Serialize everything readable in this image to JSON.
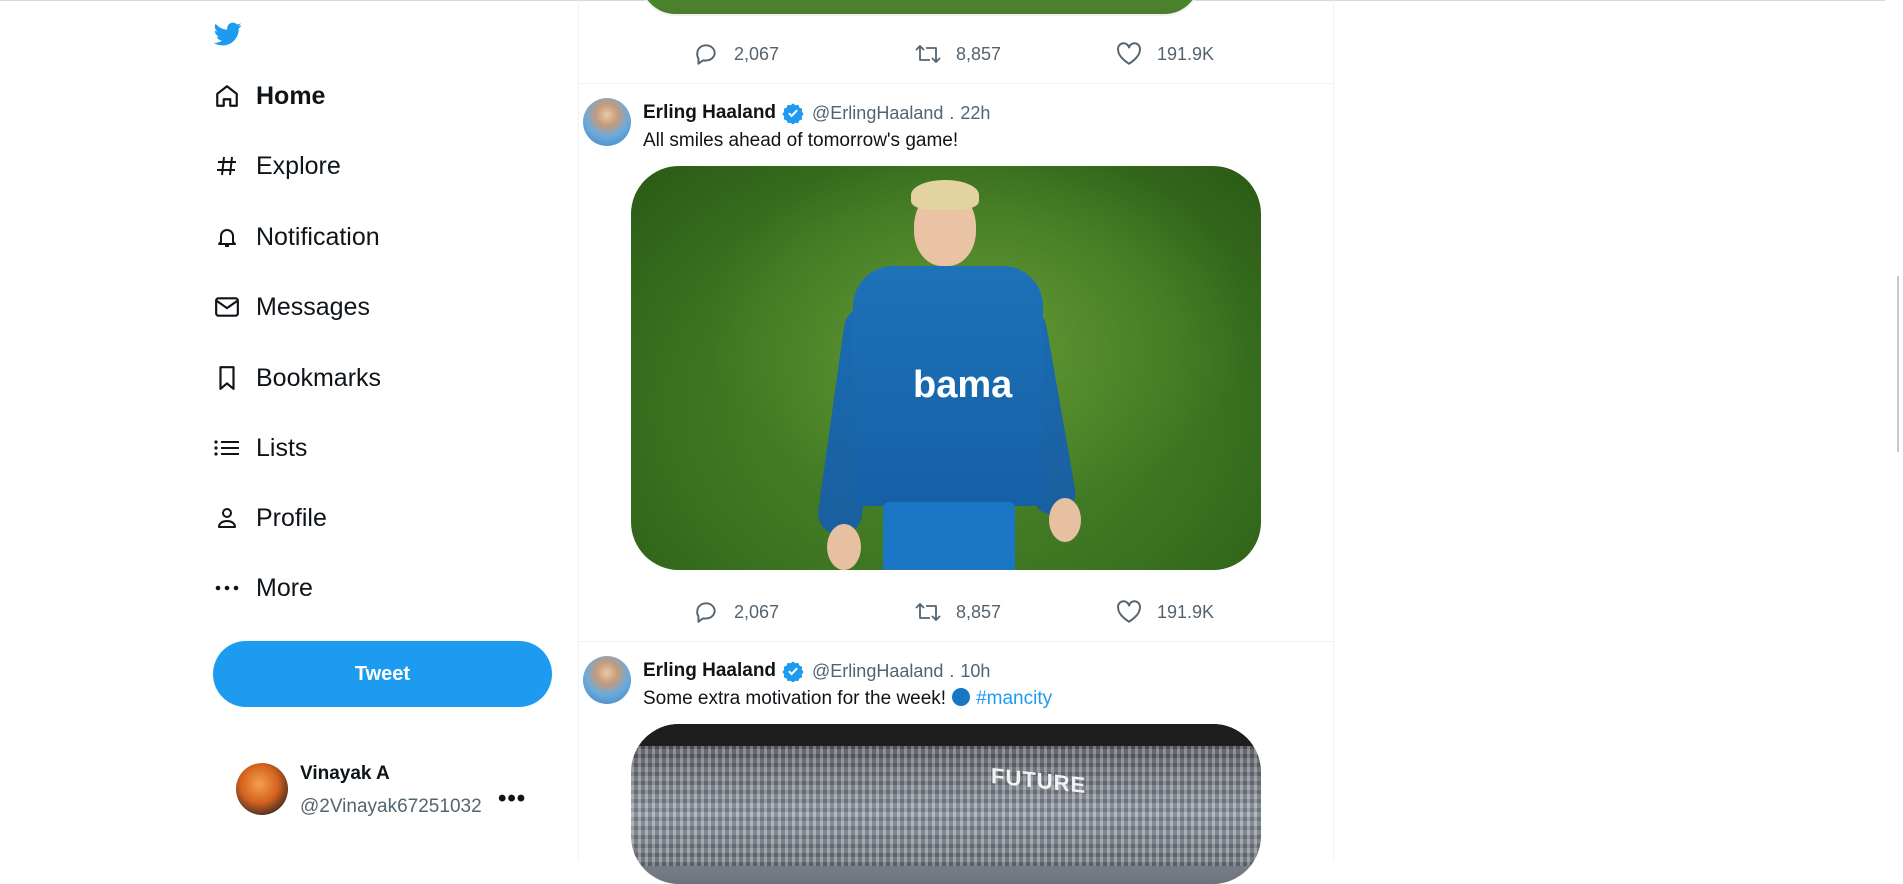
{
  "sidebar": {
    "logo_icon": "twitter-bird-icon",
    "nav": [
      {
        "label": "Home",
        "icon": "home-icon",
        "active": true
      },
      {
        "label": "Explore",
        "icon": "hashtag-icon"
      },
      {
        "label": "Notification",
        "icon": "bell-icon"
      },
      {
        "label": "Messages",
        "icon": "mail-icon"
      },
      {
        "label": "Bookmarks",
        "icon": "bookmark-icon"
      },
      {
        "label": "Lists",
        "icon": "list-icon"
      },
      {
        "label": "Profile",
        "icon": "person-icon"
      },
      {
        "label": "More",
        "icon": "more-dots-icon"
      }
    ],
    "tweet_button": "Tweet",
    "account": {
      "name": "Vinayak A",
      "handle": "@2Vinayak67251032",
      "menu": "•••"
    }
  },
  "feed": {
    "top_actions": {
      "replies": "2,067",
      "retweets": "8,857",
      "likes": "191.9K"
    },
    "tweets": [
      {
        "name": "Erling Haaland",
        "handle": "@ErlingHaaland",
        "separator": ".",
        "time": "22h",
        "text": "All smiles ahead of tomorrow's game!",
        "media_logo_text": "bama",
        "actions": {
          "replies": "2,067",
          "retweets": "8,857",
          "likes": "191.9K"
        }
      },
      {
        "name": "Erling Haaland",
        "handle": "@ErlingHaaland",
        "separator": ".",
        "time": "10h",
        "text": "Some extra motivation for the week!",
        "hashtag": "#mancity",
        "media_board_text": "FUTURE"
      }
    ]
  },
  "colors": {
    "accent": "#1d9bf0",
    "text": "#0f1419",
    "muted": "#536471"
  }
}
